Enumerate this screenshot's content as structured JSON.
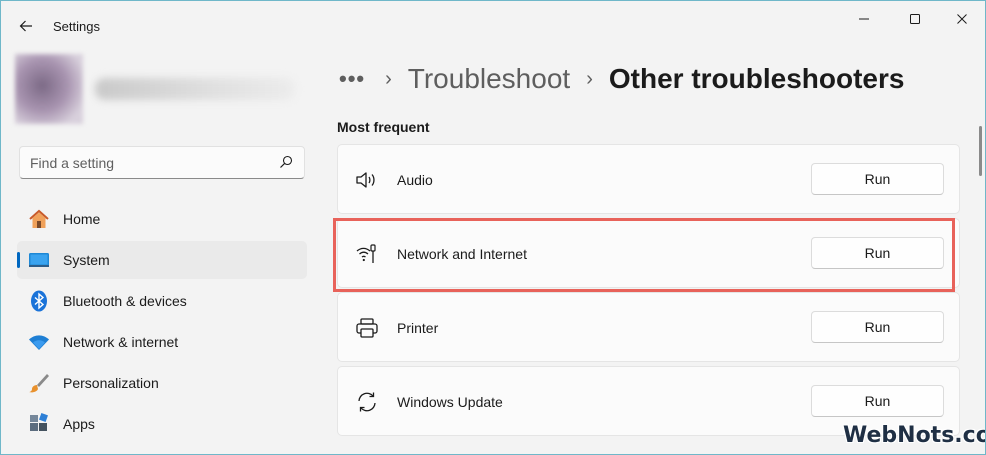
{
  "window": {
    "title": "Settings",
    "controls": [
      "minimize-icon",
      "maximize-icon",
      "close-icon"
    ]
  },
  "sidebar": {
    "search": {
      "placeholder": "Find a setting",
      "value": ""
    },
    "items": [
      {
        "label": "Home",
        "icon": "home-icon",
        "active": false
      },
      {
        "label": "System",
        "icon": "system-display-icon",
        "active": true
      },
      {
        "label": "Bluetooth & devices",
        "icon": "bluetooth-icon",
        "active": false
      },
      {
        "label": "Network & internet",
        "icon": "wifi-icon",
        "active": false
      },
      {
        "label": "Personalization",
        "icon": "brush-icon",
        "active": false
      },
      {
        "label": "Apps",
        "icon": "apps-icon",
        "active": false
      }
    ]
  },
  "breadcrumb": {
    "more": "•••",
    "separator": "›",
    "parent": "Troubleshoot",
    "current": "Other troubleshooters"
  },
  "main": {
    "section_title": "Most frequent",
    "troubleshooters": [
      {
        "label": "Audio",
        "icon": "speaker-icon",
        "button": "Run"
      },
      {
        "label": "Network and Internet",
        "icon": "network-icon",
        "button": "Run",
        "highlighted": true
      },
      {
        "label": "Printer",
        "icon": "printer-icon",
        "button": "Run"
      },
      {
        "label": "Windows Update",
        "icon": "refresh-icon",
        "button": "Run"
      }
    ]
  },
  "watermark": "WebNots.com",
  "colors": {
    "accent": "#0067c0",
    "highlight_border": "#e8625a",
    "background": "#f3f3f3",
    "card": "#fbfbfb"
  }
}
